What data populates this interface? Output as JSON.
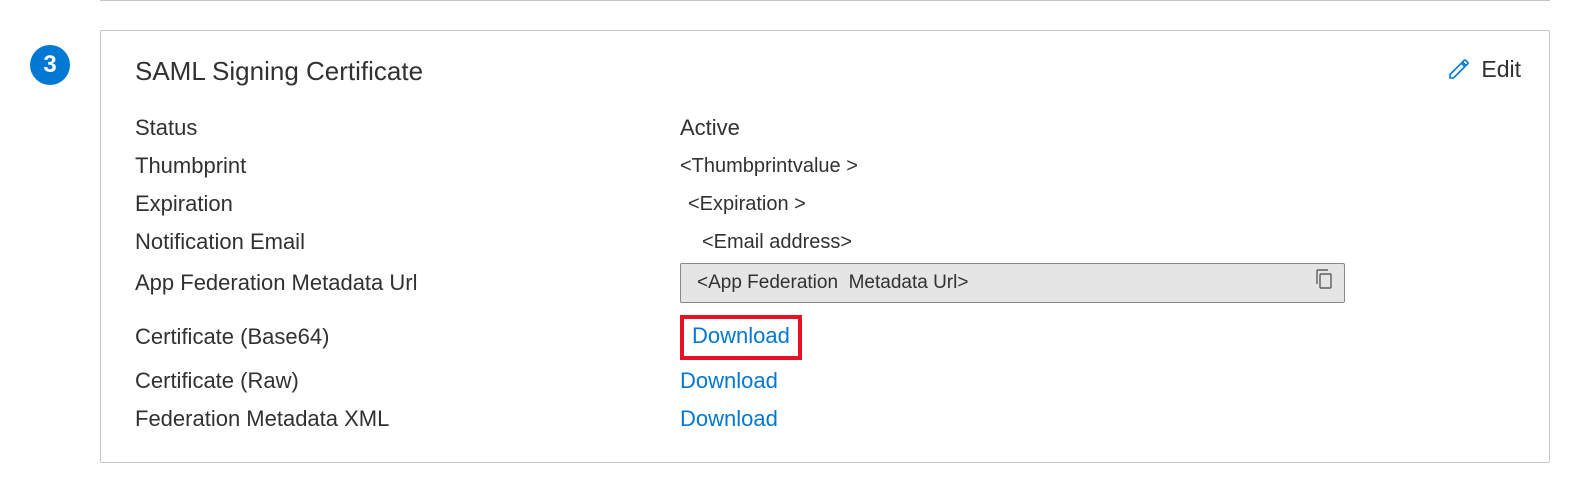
{
  "step": "3",
  "card": {
    "title": "SAML Signing Certificate",
    "editLabel": "Edit"
  },
  "fields": {
    "status": {
      "label": "Status",
      "value": "Active"
    },
    "thumbprint": {
      "label": "Thumbprint",
      "value": "<Thumbprintvalue >"
    },
    "expiration": {
      "label": "Expiration",
      "value": "<Expiration >"
    },
    "notificationEmail": {
      "label": "Notification Email",
      "value": "<Email address>"
    },
    "metadataUrl": {
      "label": "App Federation Metadata Url",
      "value": "<App Federation  Metadata Url>"
    },
    "certBase64": {
      "label": "Certificate (Base64)",
      "link": "Download"
    },
    "certRaw": {
      "label": "Certificate (Raw)",
      "link": "Download"
    },
    "fedXml": {
      "label": "Federation Metadata XML",
      "link": "Download"
    }
  }
}
